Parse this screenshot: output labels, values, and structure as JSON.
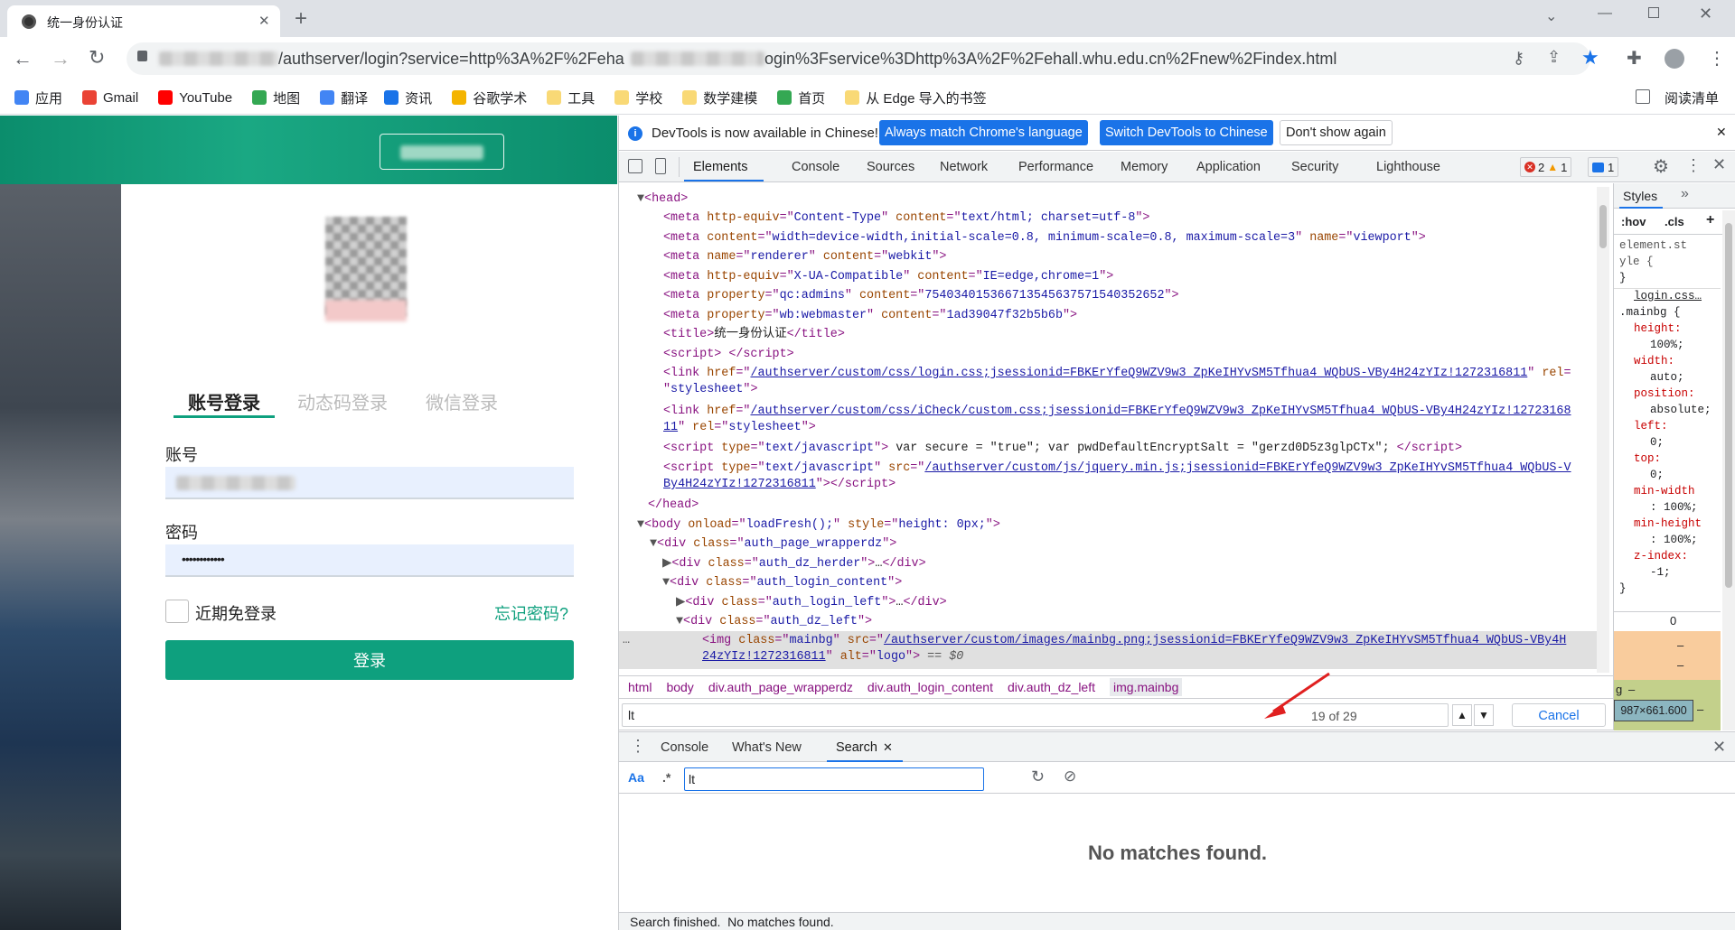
{
  "browser": {
    "tab_title": "统一身份认证",
    "url_fragment_1": "/authserver/login?service=http%3A%2F%2Feha",
    "url_fragment_2": "ogin%3Fservice%3Dhttp%3A%2F%2Fehall.whu.edu.cn%2Fnew%2Findex.html"
  },
  "bookmarks": [
    {
      "label": "应用",
      "color": "#4285f4"
    },
    {
      "label": "Gmail",
      "color": "#ea4335"
    },
    {
      "label": "YouTube",
      "color": "#ff0000"
    },
    {
      "label": "地图",
      "color": "#34a853"
    },
    {
      "label": "翻译",
      "color": "#4285f4"
    },
    {
      "label": "资讯",
      "color": "#1a73e8"
    },
    {
      "label": "谷歌学术",
      "color": "#f4b400"
    },
    {
      "label": "工具",
      "color": "#f9d976"
    },
    {
      "label": "学校",
      "color": "#f9d976"
    },
    {
      "label": "数学建模",
      "color": "#f9d976"
    },
    {
      "label": "首页",
      "color": "#34a853"
    },
    {
      "label": "从 Edge 导入的书签",
      "color": "#f9d976"
    }
  ],
  "reading_list": "阅读清单",
  "login": {
    "tabs": [
      "账号登录",
      "动态码登录",
      "微信登录"
    ],
    "account_label": "账号",
    "password_label": "密码",
    "password_value": "••••••••••••",
    "remember_label": "近期免登录",
    "forgot_label": "忘记密码?",
    "submit_label": "登录",
    "accent": "#0ea07e"
  },
  "devtools": {
    "banner": {
      "text": "DevTools is now available in Chinese!",
      "btn1": "Always match Chrome's language",
      "btn2": "Switch DevTools to Chinese",
      "btn3": "Don't show again"
    },
    "tabs": [
      "Elements",
      "Console",
      "Sources",
      "Network",
      "Performance",
      "Memory",
      "Application",
      "Security",
      "Lighthouse"
    ],
    "errors": "2",
    "warnings": "1",
    "messages": "1",
    "breadcrumb": [
      "html",
      "body",
      "div.auth_page_wrapperdz",
      "div.auth_login_content",
      "div.auth_dz_left",
      "img.mainbg"
    ],
    "find_value": "lt",
    "find_count": "19 of 29",
    "cancel": "Cancel",
    "drawer_tabs": [
      "Console",
      "What's New",
      "Search"
    ],
    "search_value": "lt",
    "no_matches": "No matches found.",
    "status": "Search finished.  No matches found.",
    "styles": {
      "tab": "Styles",
      "hov": ":hov",
      "cls": ".cls",
      "element_style_1": "element.st",
      "element_style_2": "yle {",
      "close_brace": "}",
      "source": "login.css…",
      "selector": ".mainbg {",
      "props": [
        [
          "height:",
          "100%;"
        ],
        [
          "width:",
          "auto;"
        ],
        [
          "position:",
          "absolute;"
        ],
        [
          "left:",
          "0;"
        ],
        [
          "top:",
          "0;"
        ],
        [
          "min-width",
          ": 100%;"
        ],
        [
          "min-height",
          ": 100%;"
        ],
        [
          "z-index:",
          "-1;"
        ]
      ],
      "box_zero": "0",
      "box_dash": "–",
      "box_g": "g",
      "dims": "987×661.600"
    }
  }
}
